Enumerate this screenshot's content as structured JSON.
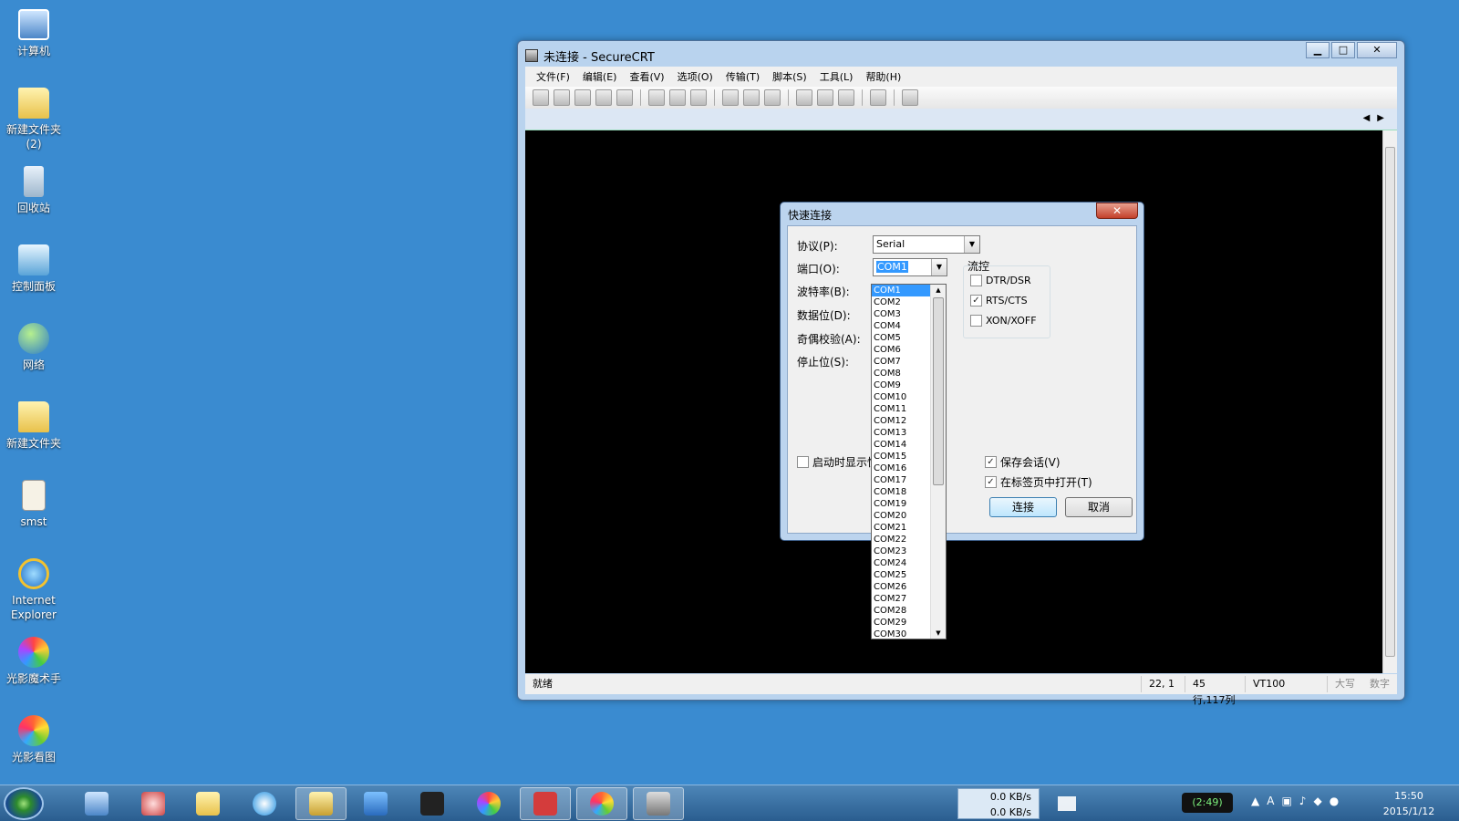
{
  "desktop": {
    "icons": [
      {
        "label": "计算机",
        "icon": "computer-icon"
      },
      {
        "label": "新建文件夹\n(2)",
        "icon": "folder-icon"
      },
      {
        "label": "回收站",
        "icon": "recycle-bin-icon"
      },
      {
        "label": "控制面板",
        "icon": "control-panel-icon"
      },
      {
        "label": "网络",
        "icon": "network-icon"
      },
      {
        "label": "新建文件夹",
        "icon": "folder-icon"
      },
      {
        "label": "smst",
        "icon": "document-shortcut-icon"
      },
      {
        "label": "Internet\nExplorer",
        "icon": "internet-explorer-icon"
      },
      {
        "label": "光影魔术手",
        "icon": "photo-editor-icon"
      },
      {
        "label": "光影看图",
        "icon": "photo-viewer-icon"
      }
    ]
  },
  "window": {
    "title": "未连接 - SecureCRT",
    "menu": [
      "文件(F)",
      "编辑(E)",
      "查看(V)",
      "选项(O)",
      "传输(T)",
      "脚本(S)",
      "工具(L)",
      "帮助(H)"
    ],
    "status": {
      "text": "就绪",
      "cursor": "22,  1",
      "size": "45行,117列",
      "terminal": "VT100",
      "caps": "大写",
      "num": "数字"
    }
  },
  "dialog": {
    "title": "快速连接",
    "protocol_label": "协议(P):",
    "protocol_value": "Serial",
    "port_label": "端口(O):",
    "port_value": "COM1",
    "baud_label": "波特率(B):",
    "databits_label": "数据位(D):",
    "parity_label": "奇偶校验(A):",
    "stopbits_label": "停止位(S):",
    "flow_label": "流控",
    "flow": {
      "dtr": {
        "label": "DTR/DSR",
        "checked": false
      },
      "rts": {
        "label": "RTS/CTS",
        "checked": true
      },
      "xon": {
        "label": "XON/XOFF",
        "checked": false
      }
    },
    "show_on_startup": "启动时显示快",
    "save_session": "保存会话(V)",
    "open_in_tab": "在标签页中打开(T)",
    "connect_btn": "连接",
    "cancel_btn": "取消",
    "port_options": [
      "COM1",
      "COM2",
      "COM3",
      "COM4",
      "COM5",
      "COM6",
      "COM7",
      "COM8",
      "COM9",
      "COM10",
      "COM11",
      "COM12",
      "COM13",
      "COM14",
      "COM15",
      "COM16",
      "COM17",
      "COM18",
      "COM19",
      "COM20",
      "COM21",
      "COM22",
      "COM23",
      "COM24",
      "COM25",
      "COM26",
      "COM27",
      "COM28",
      "COM29",
      "COM30"
    ]
  },
  "taskbar": {
    "net_down": "0.0 KB/s",
    "net_up": "0.0 KB/s",
    "battery": "(2:49)",
    "time": "15:50",
    "date": "2015/1/12"
  }
}
